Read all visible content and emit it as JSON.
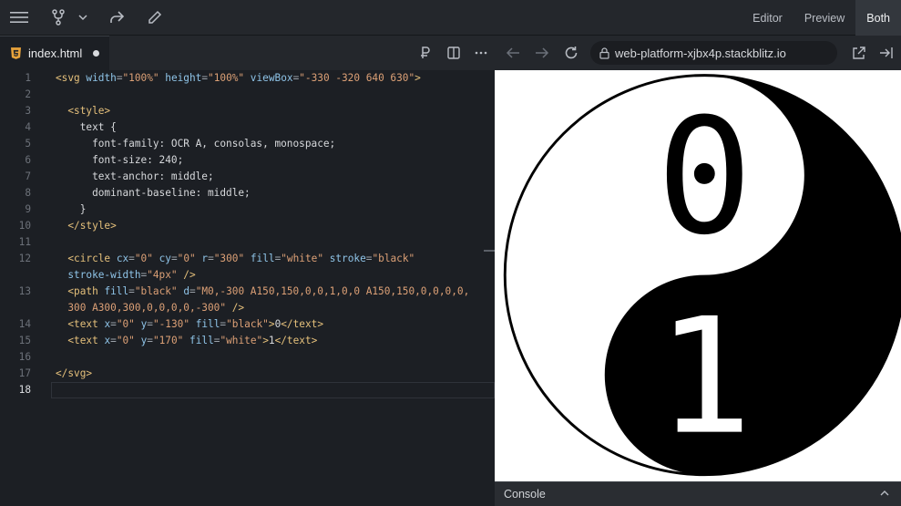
{
  "toolbar": {
    "icons": [
      "menu-icon",
      "fork-icon",
      "chevron-down-icon",
      "share-icon",
      "edit-icon"
    ],
    "view_modes": {
      "editor": "Editor",
      "preview": "Preview",
      "both": "Both"
    },
    "active_view": "Both"
  },
  "editor_tab": {
    "filename": "index.html",
    "unsaved": true
  },
  "preview_bar": {
    "icons": [
      "prettier-icon",
      "split-view-icon",
      "more-icon",
      "back-icon",
      "forward-icon",
      "reload-icon",
      "open-external-icon",
      "collapse-panel-icon"
    ],
    "url": "web-platform-xjbx4p.stackblitz.io"
  },
  "code": {
    "line_numbers": [
      "1",
      "2",
      "3",
      "4",
      "5",
      "6",
      "7",
      "8",
      "9",
      "10",
      "11",
      "12",
      "13",
      "14",
      "15",
      "16",
      "17",
      "18"
    ],
    "current_line": "18"
  },
  "preview": {
    "svg_view_box": "-330 -320 640 630",
    "digit_top": "0",
    "digit_bottom": "1"
  },
  "console": {
    "label": "Console"
  },
  "colors": {
    "editor_bg": "#1c1f24",
    "toolbar_bg": "#24272c",
    "tag": "#e5c07b",
    "attribute": "#8fc4e8",
    "string": "#dca076"
  }
}
